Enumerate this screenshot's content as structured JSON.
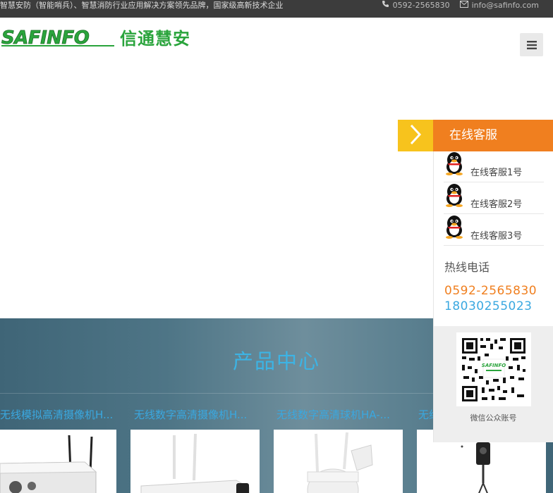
{
  "topbar": {
    "tagline": "智慧安防（智能哨兵）、智慧消防行业应用解决方案领先品牌，国家级高新技术企业",
    "phone": "0592-2565830",
    "email": "info@safinfo.com",
    "phone_icon": "phone-icon",
    "email_icon": "envelope-icon"
  },
  "header": {
    "logo_text": "SAFINFO",
    "logo_cn": "信通慧安",
    "menu_icon": "hamburger-icon"
  },
  "products": {
    "title": "产品中心",
    "items": [
      {
        "label": "无线模拟高清摄像机H..."
      },
      {
        "label": "无线数字高清摄像机H..."
      },
      {
        "label": "无线数字高清球机HA-..."
      },
      {
        "label": "无线..."
      }
    ]
  },
  "service": {
    "title": "在线客服",
    "agents": [
      {
        "label": "在线客服1号"
      },
      {
        "label": "在线客服2号"
      },
      {
        "label": "在线客服3号"
      }
    ],
    "hotline_title": "热线电话",
    "phone1": "0592-2565830",
    "phone2": "18030255023",
    "qr_caption": "微信公众账号"
  },
  "colors": {
    "accent_orange": "#f07f1f",
    "accent_yellow": "#f7c31d",
    "accent_blue": "#3aa8e0",
    "brand_green": "#2aa43c"
  }
}
